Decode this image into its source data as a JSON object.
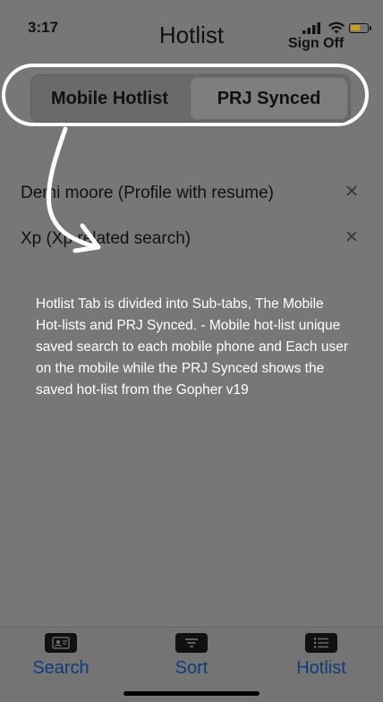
{
  "status": {
    "time": "3:17"
  },
  "header": {
    "title": "Hotlist",
    "sign_off": "Sign Off"
  },
  "segments": [
    {
      "label": "Mobile Hotlist",
      "selected": false
    },
    {
      "label": "PRJ Synced",
      "selected": true
    }
  ],
  "list": [
    {
      "label": "Demi moore (Profile with resume)"
    },
    {
      "label": "Xp (Xp related search)"
    }
  ],
  "annotation": "Hotlist Tab is divided into Sub-tabs, The Mobile Hot-lists and PRJ Synced. - Mobile hot-list unique saved search  to each mobile phone and Each user on the mobile while the PRJ Synced shows the saved hot-list from the Gopher v19",
  "tabs": [
    {
      "label": "Search",
      "icon": "contact-card-icon"
    },
    {
      "label": "Sort",
      "icon": "sort-icon"
    },
    {
      "label": "Hotlist",
      "icon": "list-icon"
    }
  ],
  "colors": {
    "background": "#777777",
    "tab_label": "#0b3e7a",
    "battery": "#c9a21a",
    "annotation_text": "#ffffff"
  }
}
